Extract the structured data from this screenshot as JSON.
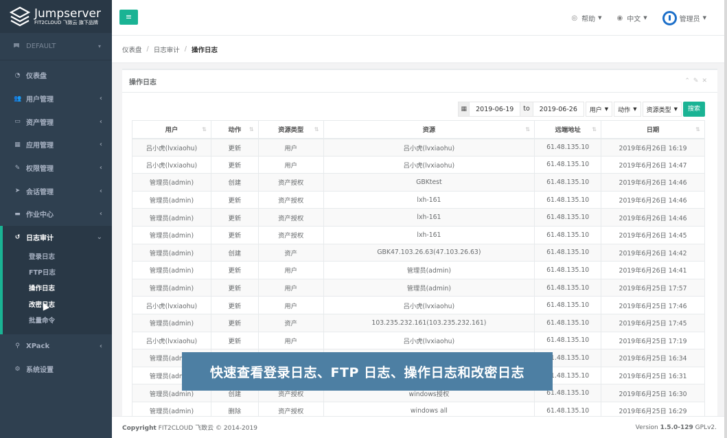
{
  "brand": {
    "name": "Jumpserver",
    "sub": "FIT2CLOUD 飞致云 旗下品牌"
  },
  "org": {
    "label": "DEFAULT"
  },
  "nav": {
    "dashboard": "仪表盘",
    "users": "用户管理",
    "assets": "资产管理",
    "apps": "应用管理",
    "perms": "权限管理",
    "sessions": "会话管理",
    "ops": "作业中心",
    "audits": "日志审计",
    "xpack": "XPack",
    "settings": "系统设置",
    "audit_sub": [
      "登录日志",
      "FTP日志",
      "操作日志",
      "改密日志",
      "批量命令"
    ]
  },
  "top": {
    "help": "帮助",
    "lang": "中文",
    "user": "管理员"
  },
  "breadcrumb": {
    "home": "仪表盘",
    "parent": "日志审计",
    "current": "操作日志"
  },
  "panel": {
    "title": "操作日志"
  },
  "filters": {
    "date_from": "2019-06-19",
    "to": "to",
    "date_to": "2019-06-26",
    "user": "用户",
    "action": "动作",
    "resource_type": "资源类型",
    "search": "搜索"
  },
  "table": {
    "headers": [
      "用户",
      "动作",
      "资源类型",
      "资源",
      "远端地址",
      "日期"
    ],
    "rows": [
      [
        "吕小虎(lvxiaohu)",
        "更新",
        "用户",
        "吕小虎(lvxiaohu)",
        "61.48.135.10",
        "2019年6月26日 16:19"
      ],
      [
        "吕小虎(lvxiaohu)",
        "更新",
        "用户",
        "吕小虎(lvxiaohu)",
        "61.48.135.10",
        "2019年6月26日 14:47"
      ],
      [
        "管理员(admin)",
        "创建",
        "资产授权",
        "GBKtest",
        "61.48.135.10",
        "2019年6月26日 14:46"
      ],
      [
        "管理员(admin)",
        "更新",
        "资产授权",
        "lxh-161",
        "61.48.135.10",
        "2019年6月26日 14:46"
      ],
      [
        "管理员(admin)",
        "更新",
        "资产授权",
        "lxh-161",
        "61.48.135.10",
        "2019年6月26日 14:46"
      ],
      [
        "管理员(admin)",
        "更新",
        "资产授权",
        "lxh-161",
        "61.48.135.10",
        "2019年6月26日 14:45"
      ],
      [
        "管理员(admin)",
        "创建",
        "资产",
        "GBK47.103.26.63(47.103.26.63)",
        "61.48.135.10",
        "2019年6月26日 14:42"
      ],
      [
        "管理员(admin)",
        "更新",
        "用户",
        "管理员(admin)",
        "61.48.135.10",
        "2019年6月26日 14:41"
      ],
      [
        "管理员(admin)",
        "更新",
        "用户",
        "管理员(admin)",
        "61.48.135.10",
        "2019年6月25日 17:57"
      ],
      [
        "吕小虎(lvxiaohu)",
        "更新",
        "用户",
        "吕小虎(lvxiaohu)",
        "61.48.135.10",
        "2019年6月25日 17:46"
      ],
      [
        "管理员(admin)",
        "更新",
        "资产",
        "103.235.232.161(103.235.232.161)",
        "61.48.135.10",
        "2019年6月25日 17:45"
      ],
      [
        "吕小虎(lvxiaohu)",
        "更新",
        "用户",
        "吕小虎(lvxiaohu)",
        "61.48.135.10",
        "2019年6月25日 17:19"
      ],
      [
        "管理员(admin)",
        "",
        "",
        "",
        "61.48.135.10",
        "2019年6月25日 16:34"
      ],
      [
        "管理员(admin)",
        "",
        "",
        "",
        "61.48.135.10",
        "2019年6月25日 16:31"
      ],
      [
        "管理员(admin)",
        "创建",
        "资产授权",
        "windows授权",
        "61.48.135.10",
        "2019年6月25日 16:30"
      ],
      [
        "管理员(admin)",
        "删除",
        "资产授权",
        "windows all",
        "61.48.135.10",
        "2019年6月25日 16:29"
      ]
    ]
  },
  "footer": {
    "copyright_bold": "Copyright",
    "copyright": "FIT2CLOUD 飞致云 © 2014-2019",
    "version_label": "Version",
    "version": "1.5.0-129",
    "license": "GPLv2."
  },
  "overlay": {
    "caption": "快速查看登录日志、FTP 日志、操作日志和改密日志"
  },
  "colors": {
    "sidebar": "#2f4050",
    "accent": "#1ab394",
    "overlay": "#4d7fa3"
  },
  "icons": [
    "logo-icon",
    "flag-icon",
    "dashboard-icon",
    "users-icon",
    "assets-icon",
    "apps-icon",
    "perms-icon",
    "sessions-icon",
    "ops-icon",
    "audits-icon",
    "xpack-icon",
    "settings-icon",
    "menu-icon",
    "help-icon",
    "globe-icon",
    "power-icon",
    "calendar-icon",
    "sort-icon"
  ]
}
